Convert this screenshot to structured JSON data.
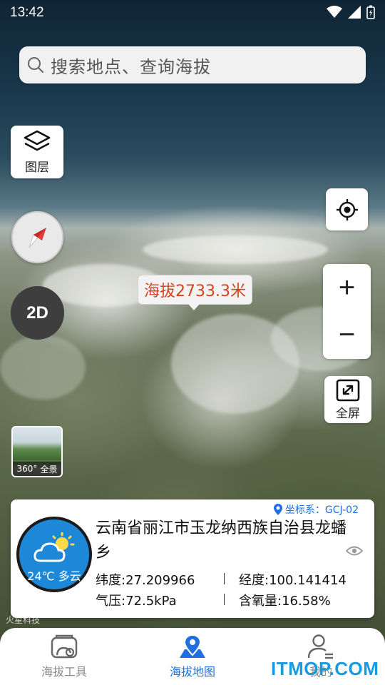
{
  "status_bar": {
    "time": "13:42"
  },
  "search": {
    "placeholder": "搜索地点、查询海拔"
  },
  "map_controls": {
    "layers_label": "图层",
    "mode_2d_label": "2D",
    "fullscreen_label": "全屏",
    "zoom_in": "+",
    "zoom_out": "−"
  },
  "elevation_tooltip": "海拔2733.3米",
  "panorama": {
    "badge": "360°",
    "label": "全景"
  },
  "info_card": {
    "coordinate_system": "坐标系：GCJ-02",
    "weather": {
      "text": "24℃ 多云",
      "icon": "partly-cloudy-icon"
    },
    "address": "云南省丽江市玉龙纳西族自治县龙蟠乡",
    "latitude": "纬度:27.209966",
    "longitude": "经度:100.141414",
    "pressure": "气压:72.5kPa",
    "oxygen": "含氧量:16.58%"
  },
  "map_attribution": "火星科技",
  "bottom_nav": [
    {
      "label": "海拔工具",
      "icon": "altitude-tool-icon",
      "active": false
    },
    {
      "label": "海拔地图",
      "icon": "map-pin-icon",
      "active": true
    },
    {
      "label": "我的",
      "icon": "profile-icon",
      "active": false
    }
  ],
  "watermark": "ITMOP.COM",
  "colors": {
    "accent": "#1f6fe0",
    "elevation_text": "#d8431d",
    "weather_bg": "#1e88d8"
  }
}
